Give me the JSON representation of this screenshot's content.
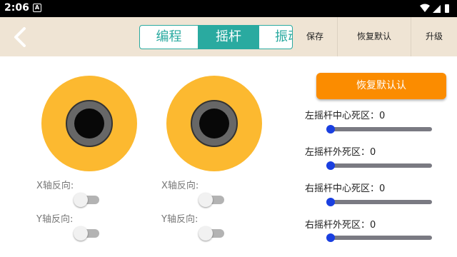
{
  "status_bar": {
    "time": "2:06",
    "notification_icon": "A"
  },
  "header": {
    "tabs": [
      {
        "label": "编程",
        "selected": false
      },
      {
        "label": "摇杆",
        "selected": true
      },
      {
        "label": "振动",
        "selected": false
      }
    ],
    "menu": {
      "save": "保存",
      "restore_default": "恢复默认",
      "upgrade": "升级"
    }
  },
  "joysticks": [
    {
      "x_invert_label": "X轴反向:",
      "x_invert": false,
      "y_invert_label": "Y轴反向:",
      "y_invert": false
    },
    {
      "x_invert_label": "X轴反向:",
      "x_invert": false,
      "y_invert_label": "Y轴反向:",
      "y_invert": false
    }
  ],
  "settings": {
    "restore_button": "恢复默认认",
    "dead_zones": [
      {
        "label": "左摇杆中心死区：0",
        "value": 0
      },
      {
        "label": "左摇杆外死区：0",
        "value": 0
      },
      {
        "label": "右摇杆中心死区：0",
        "value": 0
      },
      {
        "label": "右摇杆外死区：0",
        "value": 0
      }
    ]
  },
  "colors": {
    "accent": "#2aaaa0",
    "header_bg": "#efe4d4",
    "joystick_base": "#fcb930",
    "restore_button": "#fb8c00",
    "slider": "#1a3fe0"
  }
}
